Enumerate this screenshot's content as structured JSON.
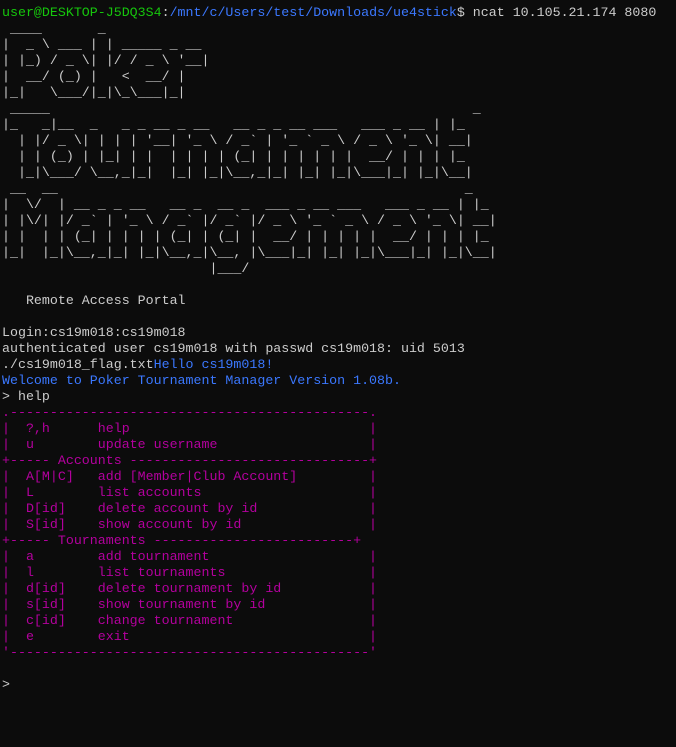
{
  "terminal": {
    "partial_top_line": "                 ",
    "prompt": {
      "user": "user@DESKTOP-J5DQ3S4",
      "sep": ":",
      "path": "/mnt/c/Users/test/Downloads/ue4stick",
      "symbol": "$",
      "command": " ncat 10.105.21.174 8080"
    },
    "banner_ascii": " ____       _\n|  _ \\ ___ | | _____ _ __\n| |_) / _ \\| |/ / _ \\ '__|\n|  __/ (_) |   <  __/ |\n|_|   \\___/|_|\\_\\___|_|\n _____                                                     _\n|_   _|__  _   _ _ __ _ __   __ _ _ __ ___   ___ _ __ | |_\n  | |/ _ \\| | | | '__| '_ \\ / _` | '_ ` _ \\ / _ \\ '_ \\| __|\n  | | (_) | |_| | |  | | | | (_| | | | | | |  __/ | | | |_\n  |_|\\___/ \\__,_|_|  |_| |_|\\__,_|_| |_| |_|\\___|_| |_|\\__|\n __  __                                                   _\n|  \\/  | __ _ _ __   __ _  __ _  ___ _ __ ___   ___ _ __ | |_\n| |\\/| |/ _` | '_ \\ / _` |/ _` |/ _ \\ '_ ` _ \\ / _ \\ '_ \\| __|\n| |  | | (_| | | | | (_| | (_| |  __/ | | | | |  __/ | | | |_\n|_|  |_|\\__,_|_| |_|\\__,_|\\__, |\\___|_| |_| |_|\\___|_| |_|\\__|\n                          |___/",
    "portal_title": "   Remote Access Portal",
    "login_line": "Login:cs19m018:cs19m018",
    "auth_line": "authenticated user cs19m018 with passwd cs19m018: uid 5013",
    "flag_file": "./cs19m018_flag.txt",
    "hello_text": "Hello cs19m018!",
    "welcome_text": "Welcome to Poker Tournament Manager Version 1.08b.",
    "help_command": "> help",
    "menu_lines": [
      ".---------------------------------------------.",
      "|  ?,h      help                              |",
      "|  u        update username                   |",
      "+----- Accounts ------------------------------+",
      "|  A[M|C]   add [Member|Club Account]         |",
      "|  L        list accounts                     |",
      "|  D[id]    delete account by id              |",
      "|  S[id]    show account by id                |",
      "+----- Tournaments -------------------------+",
      "|  a        add tournament                    |",
      "|  l        list tournaments                  |",
      "|  d[id]    delete tournament by id           |",
      "|  s[id]    show tournament by id             |",
      "|  c[id]    change tournament                 |",
      "|  e        exit                              |",
      "'---------------------------------------------'"
    ],
    "final_prompt": ">",
    "colors": {
      "background": "#0c0c0c",
      "foreground": "#cccccc",
      "user": "#16c60c",
      "path": "#3b78ff",
      "info": "#3b78ff",
      "menu": "#b4009e"
    }
  }
}
